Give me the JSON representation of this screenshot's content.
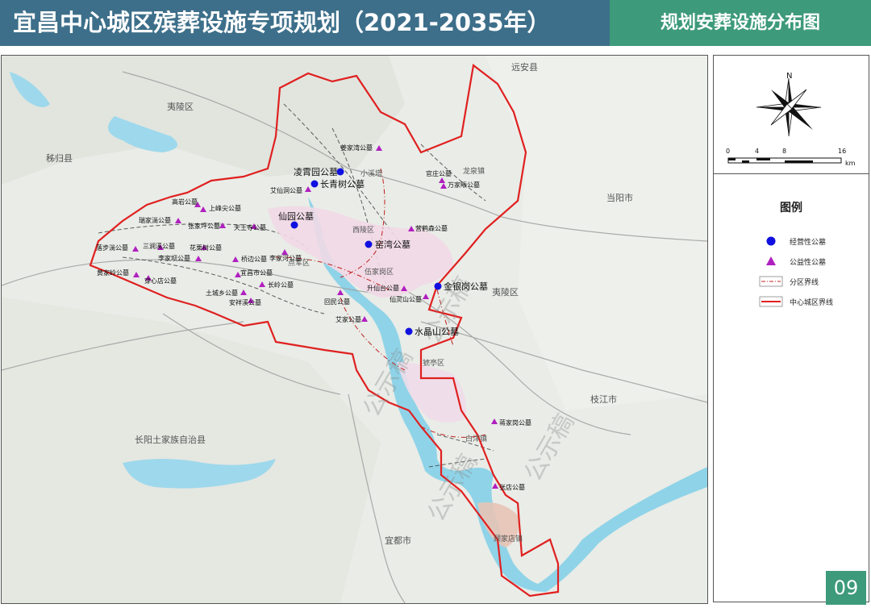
{
  "header": {
    "title": "宜昌中心城区殡葬设施专项规划（2021-2035年）",
    "subtitle": "规划安葬设施分布图"
  },
  "page_number": "09",
  "colors": {
    "title_bg": "#3d6f8a",
    "subtitle_bg": "#3d9a7a",
    "boundary": "#e02020",
    "river": "#8fd3e8",
    "commercial_marker": "#1010e0",
    "public_marker": "#b020c0"
  },
  "legend": {
    "title": "图例",
    "items": [
      {
        "label": "经营性公墓",
        "symbol": "blue-circle"
      },
      {
        "label": "公益性公墓",
        "symbol": "purple-triangle"
      },
      {
        "label": "分区界线",
        "symbol": "dash-dot-line"
      },
      {
        "label": "中心城区界线",
        "symbol": "red-double-line"
      }
    ]
  },
  "scale_bar": {
    "ticks": [
      "0",
      "4",
      "8",
      "16"
    ],
    "unit": "km"
  },
  "north_label": "N",
  "map": {
    "region_labels": [
      "夷陵区",
      "秭归县",
      "远安县",
      "当阳市",
      "枝江市",
      "长阳土家族自治县",
      "宜都市",
      "夷陵区"
    ],
    "district_labels": [
      "西陵区",
      "伍家岗区",
      "点军区",
      "猇亭区",
      "白洋镇",
      "顾家店镇",
      "龙泉镇",
      "小溪塔"
    ],
    "commercial_cemeteries": [
      "凌霄园公墓",
      "长青树公墓",
      "仙园公墓",
      "窑湾公墓",
      "金银岗公墓",
      "水晶山公墓"
    ],
    "public_cemeteries": [
      "姜家湾公墓",
      "官庄公墓",
      "万家畈公墓",
      "艾仙洞公墓",
      "营鹤森公墓",
      "高岩公墓",
      "上峰尖公墓",
      "瑞家淌公墓",
      "张家坪公墓",
      "天王寺公墓",
      "落步淌公墓",
      "三涧溪公墓",
      "花栗树公墓",
      "李家河公墓",
      "李家坝公墓",
      "桥边公墓",
      "黄家岭公墓",
      "穿心店公墓",
      "宜昌市公墓",
      "土城乡公墓",
      "长岭公墓",
      "安祥溪公墓",
      "升仙台公墓",
      "仙灵山公墓",
      "回民公墓",
      "艾家公墓",
      "蒋家岗公墓",
      "张店公墓"
    ],
    "watermark": "公示稿"
  }
}
